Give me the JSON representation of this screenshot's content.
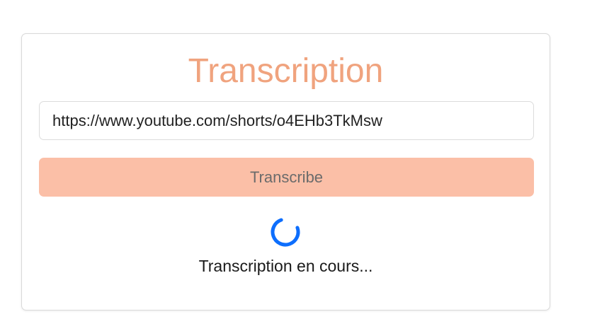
{
  "card": {
    "title": "Transcription",
    "url_input": {
      "value": "https://www.youtube.com/shorts/o4EHb3TkMsw"
    },
    "transcribe_button_label": "Transcribe",
    "status_text": "Transcription en cours...",
    "spinner_icon": "loading-spinner"
  },
  "colors": {
    "title": "#f0a37e",
    "button_bg": "#fbbfa7",
    "button_text": "#6b6b6b",
    "spinner": "#0d6efd"
  }
}
